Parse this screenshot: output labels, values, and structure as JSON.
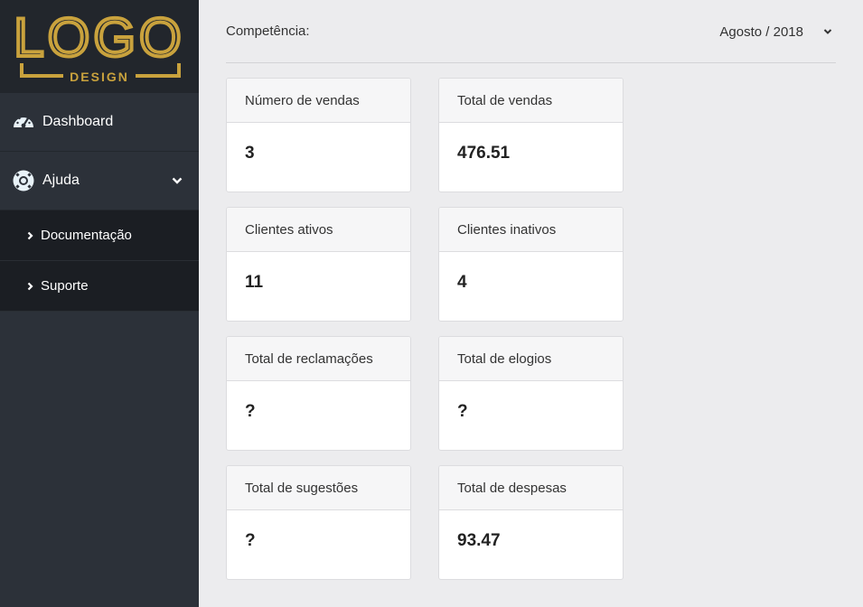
{
  "logo": {
    "text": "LOGO",
    "subtext": "DESIGN"
  },
  "sidebar": {
    "items": [
      {
        "label": "Dashboard",
        "icon": "dashboard-gauge-icon"
      },
      {
        "label": "Ajuda",
        "icon": "lifebuoy-icon",
        "expanded": true
      }
    ],
    "submenu": [
      {
        "label": "Documentação"
      },
      {
        "label": "Suporte"
      }
    ]
  },
  "header": {
    "competencia_label": "Competência:",
    "competencia_value": "Agosto / 2018"
  },
  "cards": [
    {
      "title": "Número de vendas",
      "value": "3"
    },
    {
      "title": "Total de vendas",
      "value": "476.51"
    },
    {
      "title": "Clientes ativos",
      "value": "11"
    },
    {
      "title": "Clientes inativos",
      "value": "4"
    },
    {
      "title": "Total de reclamações",
      "value": "?"
    },
    {
      "title": "Total de elogios",
      "value": "?"
    },
    {
      "title": "Total de sugestões",
      "value": "?"
    },
    {
      "title": "Total de despesas",
      "value": "93.47"
    }
  ],
  "colors": {
    "sidebar_bg": "#2c3139",
    "logo_bg": "#22262c",
    "submenu_bg": "#1b1e23",
    "logo_gold": "#c9a23d",
    "content_bg": "#ececee"
  }
}
